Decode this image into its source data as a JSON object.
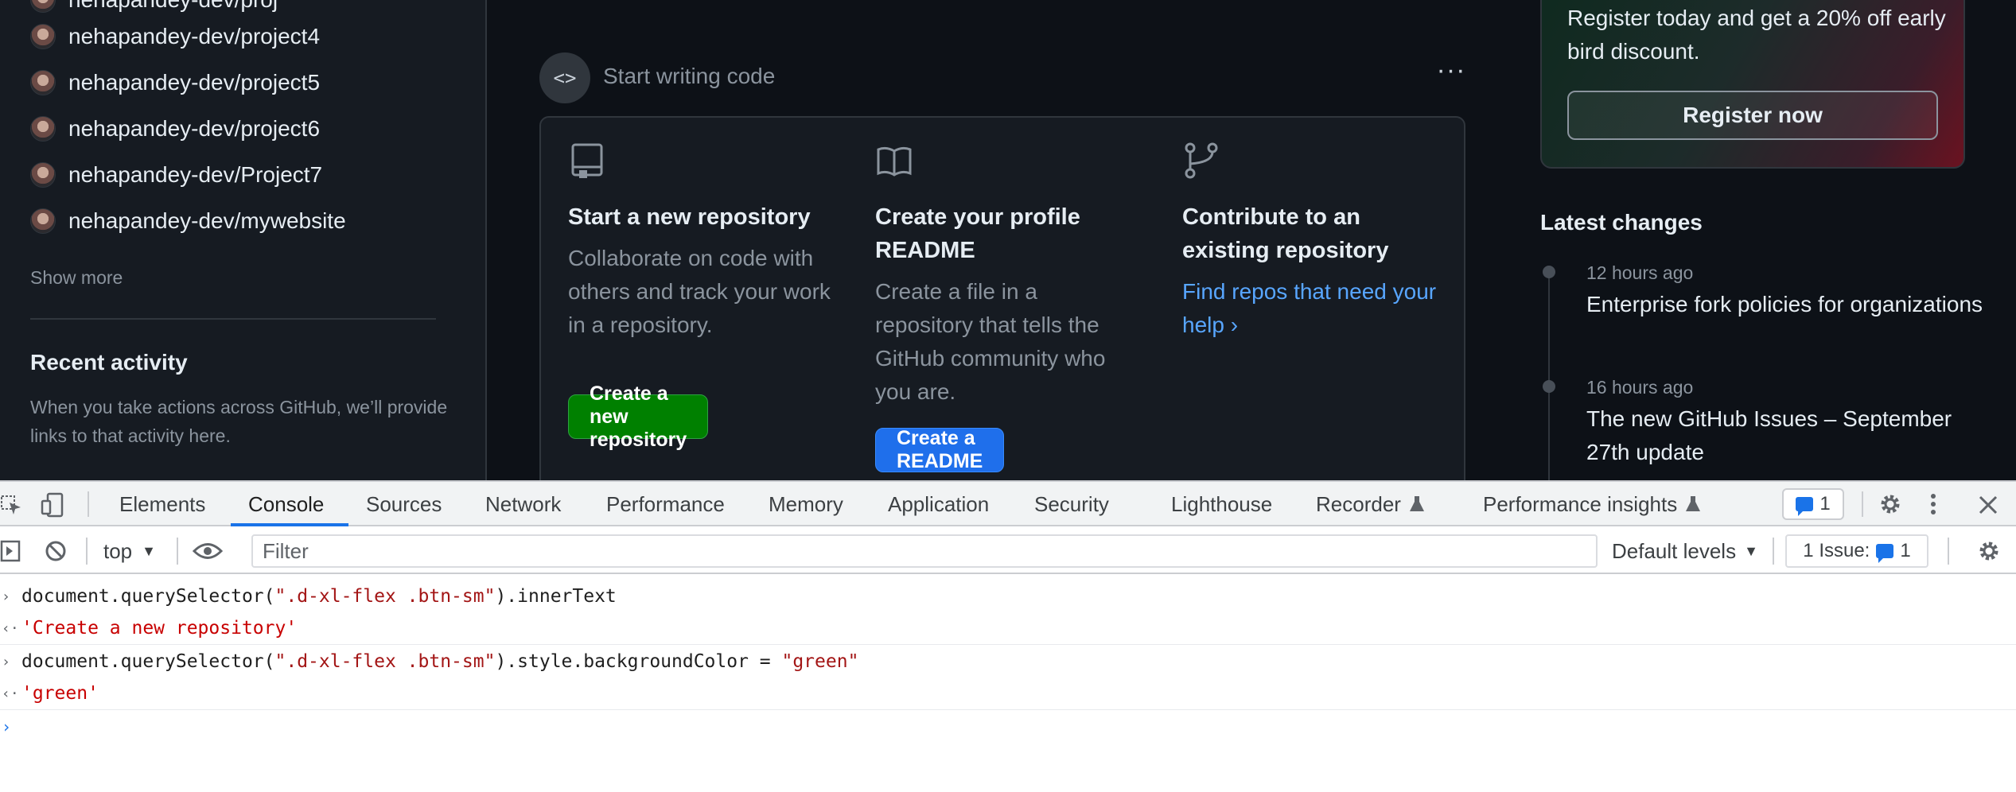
{
  "sidebar": {
    "repos": [
      "nehapandey-dev/project4",
      "nehapandey-dev/project5",
      "nehapandey-dev/project6",
      "nehapandey-dev/Project7",
      "nehapandey-dev/mywebsite"
    ],
    "show_more": "Show more",
    "recent_activity_title": "Recent activity",
    "recent_activity_desc": "When you take actions across GitHub, we’ll provide links to that activity here."
  },
  "start": {
    "label": "Start writing code",
    "icon": "code-icon",
    "more_icon": "kebab-horizontal-icon"
  },
  "cards": [
    {
      "icon": "repo-icon",
      "title": "Start a new repository",
      "desc": "Collaborate on code with others and track your work in a repository.",
      "button": "Create a new repository"
    },
    {
      "icon": "book-icon",
      "title": "Create your profile README",
      "desc": "Create a file in a repository that tells the GitHub community who you are.",
      "button": "Create a README"
    },
    {
      "icon": "git-fork-icon",
      "title": "Contribute to an existing repository",
      "link": "Find repos that need your help"
    }
  ],
  "promo": {
    "text": "Register today and get a 20% off early bird discount.",
    "button": "Register now"
  },
  "latest_changes": {
    "title": "Latest changes",
    "items": [
      {
        "time": "12 hours ago",
        "title": "Enterprise fork policies for organizations"
      },
      {
        "time": "16 hours ago",
        "title": "The new GitHub Issues – September 27th update"
      }
    ]
  },
  "devtools": {
    "tabs": [
      "Elements",
      "Console",
      "Sources",
      "Network",
      "Performance",
      "Memory",
      "Application",
      "Security",
      "Lighthouse",
      "Recorder",
      "Performance insights"
    ],
    "active_tab": "Console",
    "message_count": "1",
    "context": "top",
    "filter_placeholder": "Filter",
    "levels": "Default levels",
    "issues_label": "1 Issue:",
    "issues_count": "1",
    "colors": {
      "accent": "#1a73e8",
      "string": "#a31515",
      "button_green": "green"
    }
  },
  "console": {
    "line1": {
      "pre": "document.querySelector(",
      "str": "\".d-xl-flex .btn-sm\"",
      "post": ").innerText"
    },
    "result1": "'Create a new repository'",
    "line2": {
      "pre": "document.querySelector(",
      "str": "\".d-xl-flex .btn-sm\"",
      "post": ").style.backgroundColor = ",
      "str2": "\"green\""
    },
    "result2": "'green'"
  }
}
